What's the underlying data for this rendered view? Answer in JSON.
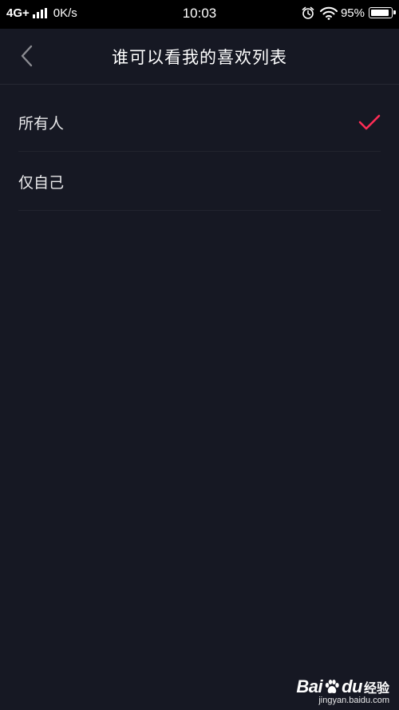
{
  "status_bar": {
    "network": "4G+",
    "speed": "0K/s",
    "time": "10:03",
    "battery": "95%",
    "battery_level": 0.95,
    "icons": [
      "signal-bars-icon",
      "alarm-clock-icon",
      "wifi-icon",
      "battery-icon"
    ]
  },
  "nav": {
    "back_icon": "chevron-left-icon",
    "title": "谁可以看我的喜欢列表"
  },
  "options": [
    {
      "label": "所有人",
      "selected": true
    },
    {
      "label": "仅自己",
      "selected": false
    }
  ],
  "colors": {
    "background": "#161823",
    "status_bar": "#000000",
    "accent_check": "#fe2c55",
    "text": "#e8e8ea",
    "divider": "#22242e"
  },
  "watermark": {
    "brand": "Bai",
    "brand_suffix": "du",
    "sub": "经验",
    "url": "jingyan.baidu.com"
  }
}
